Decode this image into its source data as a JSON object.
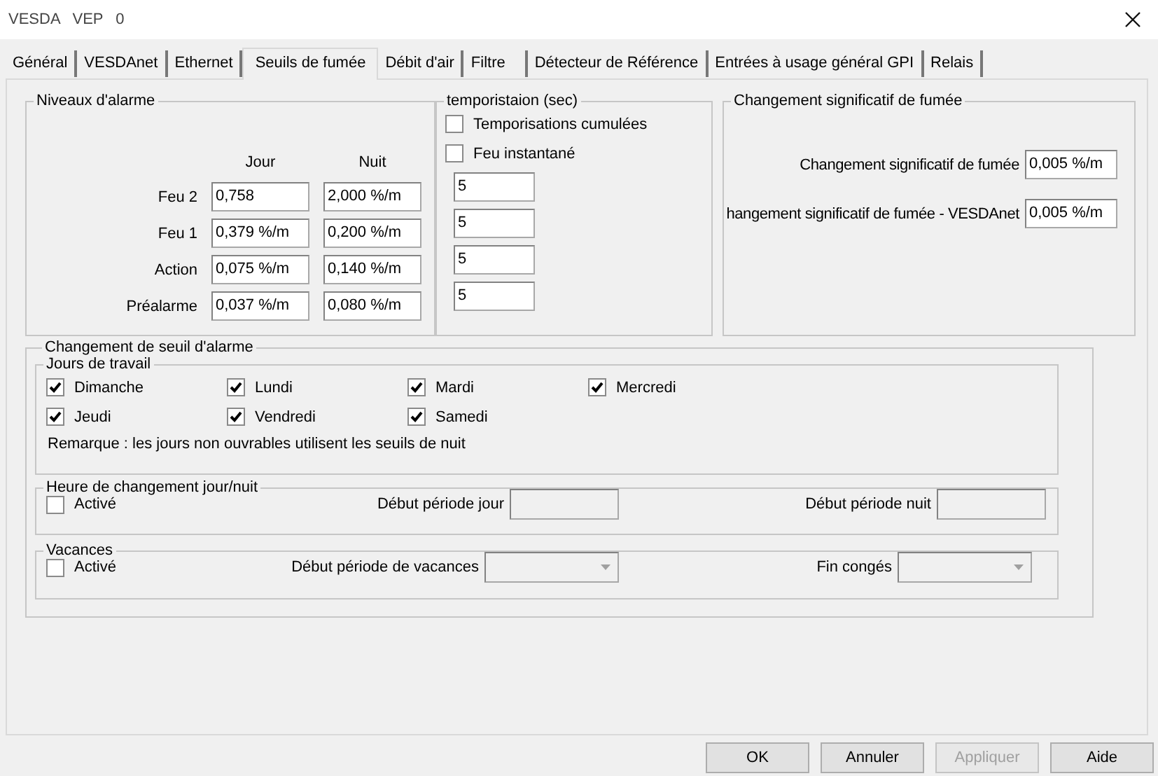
{
  "window": {
    "title": "VESDA VEP 0"
  },
  "tabs": [
    {
      "label": "Général",
      "selected": false
    },
    {
      "label": "VESDAnet",
      "selected": false
    },
    {
      "label": "Ethernet",
      "selected": false
    },
    {
      "label": "Seuils de fumée",
      "selected": true
    },
    {
      "label": "Débit d'air",
      "selected": false
    },
    {
      "label": "Filtre",
      "selected": false
    },
    {
      "label": "Détecteur de Référence",
      "selected": false
    },
    {
      "label": "Entrées à usage général GPI",
      "selected": false
    },
    {
      "label": "Relais",
      "selected": false
    }
  ],
  "alarm_levels": {
    "title": "Niveaux d'alarme",
    "columns": [
      "Jour",
      "Nuit"
    ],
    "rows": [
      {
        "label": "Feu 2",
        "day": "0,758",
        "night": "2,000 %/m"
      },
      {
        "label": "Feu 1",
        "day": "0,379 %/m",
        "night": "0,200 %/m"
      },
      {
        "label": "Action",
        "day": "0,075 %/m",
        "night": "0,140 %/m"
      },
      {
        "label": "Préalarme",
        "day": "0,037 %/m",
        "night": "0,080 %/m"
      }
    ]
  },
  "delays": {
    "title": "temporistaion (sec)",
    "options": [
      {
        "label": "Temporisations cumulées",
        "checked": false
      },
      {
        "label": "Feu instantané",
        "checked": false
      }
    ],
    "values": [
      "5",
      "5",
      "5",
      "5"
    ]
  },
  "significant_change": {
    "title": "Changement significatif de fumée",
    "fields": [
      {
        "label": "Changement significatif de fumée",
        "value": "0,005 %/m"
      },
      {
        "label": "hangement significatif de fumée - VESDAnet",
        "value": "0,005 %/m"
      }
    ]
  },
  "threshold_change": {
    "title": "Changement de seuil d'alarme",
    "workdays": {
      "title": "Jours de travail",
      "days": [
        {
          "label": "Dimanche",
          "checked": true
        },
        {
          "label": "Lundi",
          "checked": true
        },
        {
          "label": "Mardi",
          "checked": true
        },
        {
          "label": "Mercredi",
          "checked": true
        },
        {
          "label": "Jeudi",
          "checked": true
        },
        {
          "label": "Vendredi",
          "checked": true
        },
        {
          "label": "Samedi",
          "checked": true
        }
      ],
      "note": "Remarque : les jours non ouvrables utilisent les seuils de nuit"
    },
    "sections": [
      {
        "title": "Heure de changement jour/nuit",
        "enabled": {
          "label": "Activé",
          "checked": false
        },
        "fields": [
          {
            "label": "Début période jour",
            "kind": "text",
            "disabled": true
          },
          {
            "label": "Début période nuit",
            "kind": "text",
            "disabled": true
          }
        ]
      },
      {
        "title": "Vacances",
        "enabled": {
          "label": "Activé",
          "checked": false
        },
        "fields": [
          {
            "label": "Début période de vacances",
            "kind": "dropdown",
            "disabled": true
          },
          {
            "label": "Fin congés",
            "kind": "dropdown",
            "disabled": true
          }
        ]
      }
    ]
  },
  "buttons": [
    {
      "label": "OK",
      "disabled": false
    },
    {
      "label": "Annuler",
      "disabled": false
    },
    {
      "label": "Appliquer",
      "disabled": true
    },
    {
      "label": "Aide",
      "disabled": false
    }
  ]
}
